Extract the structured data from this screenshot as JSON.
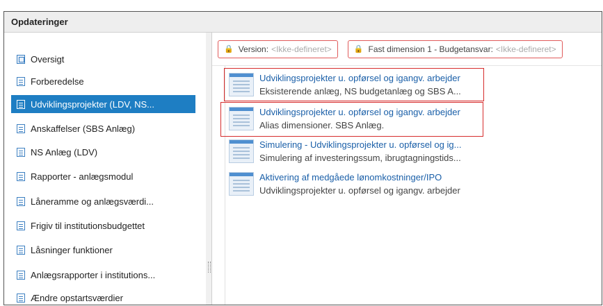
{
  "header": {
    "title": "Opdateringer"
  },
  "sidebar": {
    "items": [
      {
        "label": "Oversigt",
        "icon": "overview-icon"
      },
      {
        "label": "Forberedelse",
        "icon": "document-icon"
      },
      {
        "label": "Udviklingsprojekter (LDV, NS...",
        "icon": "document-icon",
        "active": true
      },
      {
        "label": "Anskaffelser (SBS Anlæg)",
        "icon": "document-icon"
      },
      {
        "label": "NS Anlæg (LDV)",
        "icon": "document-icon"
      },
      {
        "label": "Rapporter - anlægsmodul",
        "icon": "document-icon"
      },
      {
        "label": "Låneramme og anlægsværdi...",
        "icon": "document-icon"
      },
      {
        "label": "Frigiv til institutionsbudgettet",
        "icon": "document-icon"
      },
      {
        "label": "Låsninger funktioner",
        "icon": "document-icon"
      },
      {
        "label": "Anlægsrapporter i institutions...",
        "icon": "document-icon"
      },
      {
        "label": "Ændre opstartsværdier",
        "icon": "document-icon"
      }
    ]
  },
  "filters": [
    {
      "label": "Version:",
      "value": "<Ikke-defineret>",
      "icon": "lock-icon"
    },
    {
      "label": "Fast dimension 1 - Budgetansvar:",
      "value": "<Ikke-defineret>",
      "icon": "lock-icon"
    }
  ],
  "cards": [
    {
      "title": "Udviklingsprojekter u. opførsel og igangv. arbejder",
      "subtitle": "Eksisterende anlæg, NS budgetanlæg og SBS A...",
      "icon": "form-thumbnail-icon"
    },
    {
      "title": "Udviklingsprojekter u. opførsel og igangv. arbejder",
      "subtitle": "Alias dimensioner. SBS Anlæg.",
      "icon": "form-thumbnail-icon"
    },
    {
      "title": "Simulering - Udviklingsprojekter u. opførsel og ig...",
      "subtitle": "Simulering af investeringssum, ibrugtagningstids...",
      "icon": "form-thumbnail-icon"
    },
    {
      "title": "Aktivering af medgåede lønomkostninger/IPO",
      "subtitle": "Udviklingsprojekter u. opførsel og igangv. arbejder",
      "icon": "form-thumbnail-icon"
    }
  ],
  "colors": {
    "accent": "#1e7ec3",
    "highlight": "#d62b2b",
    "link": "#1a5fa8",
    "lock": "#d9a300"
  }
}
